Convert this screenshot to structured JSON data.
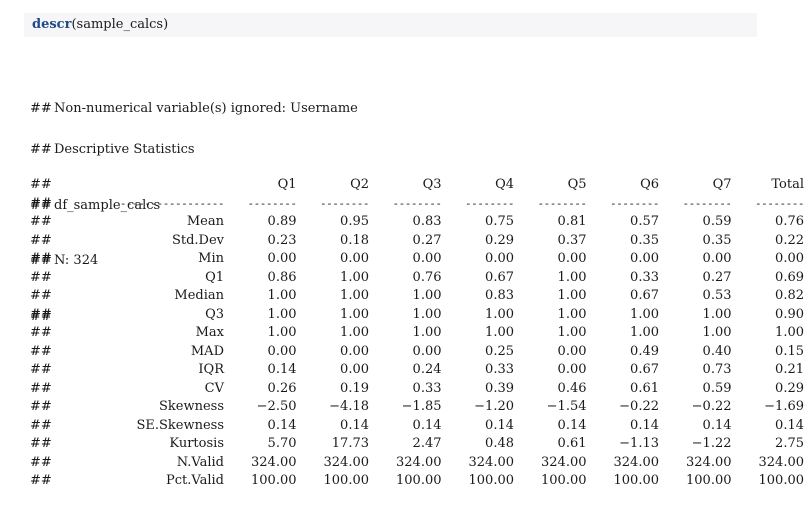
{
  "code": {
    "function": "descr",
    "args": "(sample_calcs)"
  },
  "messages": {
    "prefix": "##",
    "ignored": "Non-numerical variable(s) ignored: Username",
    "title": "Descriptive Statistics",
    "dataset": "df_sample_calcs",
    "n": "N: 324"
  },
  "table": {
    "prefix": "##",
    "columns": [
      "Q1",
      "Q2",
      "Q3",
      "Q4",
      "Q5",
      "Q6",
      "Q7",
      "Total"
    ],
    "dash_label": "-----------------",
    "dash_value": "--------",
    "rows": [
      {
        "label": "Mean",
        "values": [
          "0.89",
          "0.95",
          "0.83",
          "0.75",
          "0.81",
          "0.57",
          "0.59",
          "0.76"
        ]
      },
      {
        "label": "Std.Dev",
        "values": [
          "0.23",
          "0.18",
          "0.27",
          "0.29",
          "0.37",
          "0.35",
          "0.35",
          "0.22"
        ]
      },
      {
        "label": "Min",
        "values": [
          "0.00",
          "0.00",
          "0.00",
          "0.00",
          "0.00",
          "0.00",
          "0.00",
          "0.00"
        ]
      },
      {
        "label": "Q1",
        "values": [
          "0.86",
          "1.00",
          "0.76",
          "0.67",
          "1.00",
          "0.33",
          "0.27",
          "0.69"
        ]
      },
      {
        "label": "Median",
        "values": [
          "1.00",
          "1.00",
          "1.00",
          "0.83",
          "1.00",
          "0.67",
          "0.53",
          "0.82"
        ]
      },
      {
        "label": "Q3",
        "values": [
          "1.00",
          "1.00",
          "1.00",
          "1.00",
          "1.00",
          "1.00",
          "1.00",
          "0.90"
        ]
      },
      {
        "label": "Max",
        "values": [
          "1.00",
          "1.00",
          "1.00",
          "1.00",
          "1.00",
          "1.00",
          "1.00",
          "1.00"
        ]
      },
      {
        "label": "MAD",
        "values": [
          "0.00",
          "0.00",
          "0.00",
          "0.25",
          "0.00",
          "0.49",
          "0.40",
          "0.15"
        ]
      },
      {
        "label": "IQR",
        "values": [
          "0.14",
          "0.00",
          "0.24",
          "0.33",
          "0.00",
          "0.67",
          "0.73",
          "0.21"
        ]
      },
      {
        "label": "CV",
        "values": [
          "0.26",
          "0.19",
          "0.33",
          "0.39",
          "0.46",
          "0.61",
          "0.59",
          "0.29"
        ]
      },
      {
        "label": "Skewness",
        "values": [
          "−2.50",
          "−4.18",
          "−1.85",
          "−1.20",
          "−1.54",
          "−0.22",
          "−0.22",
          "−1.69"
        ]
      },
      {
        "label": "SE.Skewness",
        "values": [
          "0.14",
          "0.14",
          "0.14",
          "0.14",
          "0.14",
          "0.14",
          "0.14",
          "0.14"
        ]
      },
      {
        "label": "Kurtosis",
        "values": [
          "5.70",
          "17.73",
          "2.47",
          "0.48",
          "0.61",
          "−1.13",
          "−1.22",
          "2.75"
        ]
      },
      {
        "label": "N.Valid",
        "values": [
          "324.00",
          "324.00",
          "324.00",
          "324.00",
          "324.00",
          "324.00",
          "324.00",
          "324.00"
        ]
      },
      {
        "label": "Pct.Valid",
        "values": [
          "100.00",
          "100.00",
          "100.00",
          "100.00",
          "100.00",
          "100.00",
          "100.00",
          "100.00"
        ]
      }
    ]
  }
}
